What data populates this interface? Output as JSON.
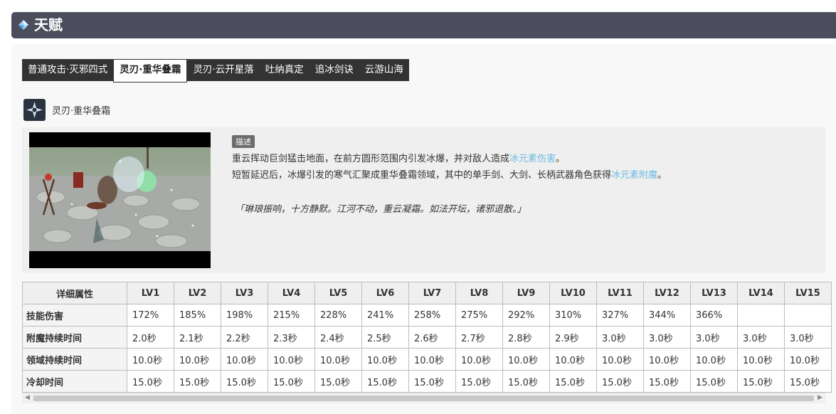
{
  "header": {
    "title": "天赋"
  },
  "tabs": [
    {
      "label": "普通攻击·灭邪四式",
      "active": false
    },
    {
      "label": "灵刃·重华叠霜",
      "active": true
    },
    {
      "label": "灵刃·云开星落",
      "active": false
    },
    {
      "label": "吐纳真定",
      "active": false
    },
    {
      "label": "追冰剑诀",
      "active": false
    },
    {
      "label": "云游山海",
      "active": false
    }
  ],
  "skill": {
    "name": "灵刃·重华叠霜",
    "desc_tag": "描述",
    "line1_pre": "重云挥动巨剑猛击地面，在前方圆形范围内引发冰爆，并对敌人造成",
    "line1_hl": "冰元素伤害",
    "line1_post": "。",
    "line2_pre": "短暂延迟后，冰爆引发的寒气汇聚成重华叠霜领域，其中的单手剑、大剑、长柄武器角色获得",
    "line2_hl": "冰元素附魔",
    "line2_post": "。",
    "quote": "「琳琅振响，十方静默。江河不动，重云凝霜。如法开坛，诸邪退散。」"
  },
  "table": {
    "header": [
      "详细属性",
      "LV1",
      "LV2",
      "LV3",
      "LV4",
      "LV5",
      "LV6",
      "LV7",
      "LV8",
      "LV9",
      "LV10",
      "LV11",
      "LV12",
      "LV13",
      "LV14",
      "LV15"
    ],
    "rows": [
      [
        "技能伤害",
        "172%",
        "185%",
        "198%",
        "215%",
        "228%",
        "241%",
        "258%",
        "275%",
        "292%",
        "310%",
        "327%",
        "344%",
        "366%",
        "",
        ""
      ],
      [
        "附魔持续时间",
        "2.0秒",
        "2.1秒",
        "2.2秒",
        "2.3秒",
        "2.4秒",
        "2.5秒",
        "2.6秒",
        "2.7秒",
        "2.8秒",
        "2.9秒",
        "3.0秒",
        "3.0秒",
        "3.0秒",
        "3.0秒",
        "3.0秒"
      ],
      [
        "领域持续时间",
        "10.0秒",
        "10.0秒",
        "10.0秒",
        "10.0秒",
        "10.0秒",
        "10.0秒",
        "10.0秒",
        "10.0秒",
        "10.0秒",
        "10.0秒",
        "10.0秒",
        "10.0秒",
        "10.0秒",
        "10.0秒",
        "10.0秒"
      ],
      [
        "冷却时间",
        "15.0秒",
        "15.0秒",
        "15.0秒",
        "15.0秒",
        "15.0秒",
        "15.0秒",
        "15.0秒",
        "15.0秒",
        "15.0秒",
        "15.0秒",
        "15.0秒",
        "15.0秒",
        "15.0秒",
        "15.0秒",
        "15.0秒"
      ]
    ]
  },
  "colors": {
    "header_bg": "#4b4d5c",
    "highlight": "#6cbbe0",
    "tab_bg": "#333333"
  }
}
